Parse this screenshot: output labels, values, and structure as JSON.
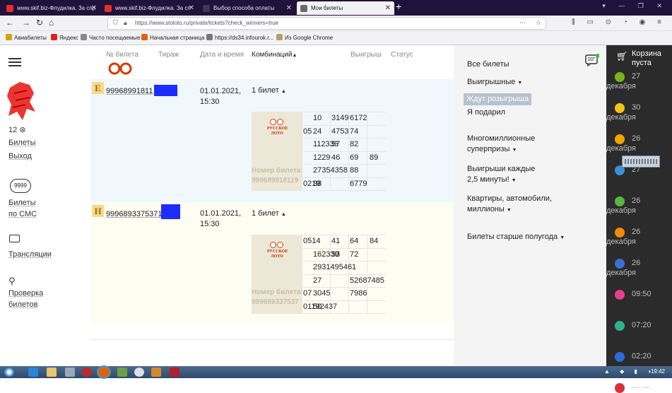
{
  "browser": {
    "tabs": [
      {
        "title": "www.skif.biz-Флудилка. За спр",
        "color": "#e0302a"
      },
      {
        "title": "www.skif.biz-Флудилка. За сп",
        "color": "#e0302a"
      },
      {
        "title": "Выбор способа оплаты",
        "color": "#3a3a50"
      },
      {
        "title": "Мои билеты",
        "color": "#6a6a6a"
      }
    ],
    "url": "https://www.stoloto.ru/private/tickets?check_winners=true",
    "bookmarks": [
      "Авиабилеты",
      "Яндекс",
      "Часто посещаемые",
      "Начальная страница",
      "https://ds34.infourok.r...",
      "Из Google Chrome"
    ]
  },
  "leftnav": {
    "bonus": "12",
    "tickets": "Билеты",
    "logout": "Выход",
    "sms_badge": "9999",
    "sms1": "Билеты",
    "sms2": "по СМС",
    "streams": "Трансляции",
    "check1": "Проверка",
    "check2": "билетов"
  },
  "table": {
    "headers": {
      "number": "№ билета",
      "draw": "Тираж",
      "date": "Дата и время",
      "comb": "Комбинаций",
      "win": "Выигрыш",
      "status": "Статус"
    }
  },
  "tickets": [
    {
      "badge": "Е",
      "number": "99968991811",
      "date1": "01.01.2021,",
      "date2": "15:30",
      "comb": "1 билет",
      "label1": "Номер билета:",
      "label2": "999689918119",
      "cells": [
        [
          "",
          "10",
          "3149",
          "6172"
        ],
        [
          "05",
          "24",
          "4753",
          "74"
        ],
        [
          "",
          "112336",
          "57",
          "82"
        ],
        [
          "",
          "1229",
          "46",
          "69",
          "89"
        ],
        [
          "",
          "27354358",
          "",
          "88"
        ],
        [
          "0219",
          "38",
          "",
          "6779"
        ]
      ]
    },
    {
      "badge": "Н",
      "number": "9996893375371",
      "date1": "01.01.2021,",
      "date2": "15:30",
      "comb": "1 билет",
      "label1": "Номер билета:",
      "label2": "999689337537",
      "cells": [
        [
          "0514",
          "",
          "41",
          "64",
          "84"
        ],
        [
          "",
          "162339",
          "53",
          "72"
        ],
        [
          "",
          "2931495461"
        ],
        [
          "",
          "27",
          "",
          "52687485"
        ],
        [
          "07",
          "3045",
          "",
          "7986"
        ],
        [
          "01192437",
          "50"
        ]
      ]
    }
  ],
  "filters": {
    "all": "Все билеты",
    "winning": "Выигрышные",
    "waiting": "Ждут розыгрыша",
    "gifted": "Я подарил",
    "super1": "Многомиллионные",
    "super2": "суперпризы",
    "every1": "Выигрыши каждые",
    "every2": "2,5 минуты!",
    "flats1": "Квартиры, автомобили,",
    "flats2": "миллионы",
    "older": "Билеты старше полугода"
  },
  "cart": {
    "line1": "Корзина",
    "line2": "пуста"
  },
  "draws": [
    {
      "num": "27",
      "month": "декабря",
      "color": "#7ab317"
    },
    {
      "num": "30",
      "month": "декабря",
      "color": "#f0c419"
    },
    {
      "num": "26",
      "month": "декабря",
      "color": "#f0a500"
    },
    {
      "num": "27",
      "month": "",
      "color": "#3b8ed8"
    },
    {
      "num": "26",
      "month": "декабря",
      "color": "#56b83c"
    },
    {
      "num": "26",
      "month": "декабря",
      "color": "#f08c00"
    },
    {
      "num": "26",
      "month": "декабря",
      "color": "#3a6fd1"
    },
    {
      "num": "09:50",
      "month": "",
      "color": "#e83e8c"
    },
    {
      "num": "07:20",
      "month": "",
      "color": "#2fb38a"
    },
    {
      "num": "02:20",
      "month": "",
      "color": "#2b6cd6"
    },
    {
      "num": "— —",
      "month": "",
      "color": "#d9303c"
    }
  ],
  "taskbar": {
    "clock": "19:42"
  }
}
